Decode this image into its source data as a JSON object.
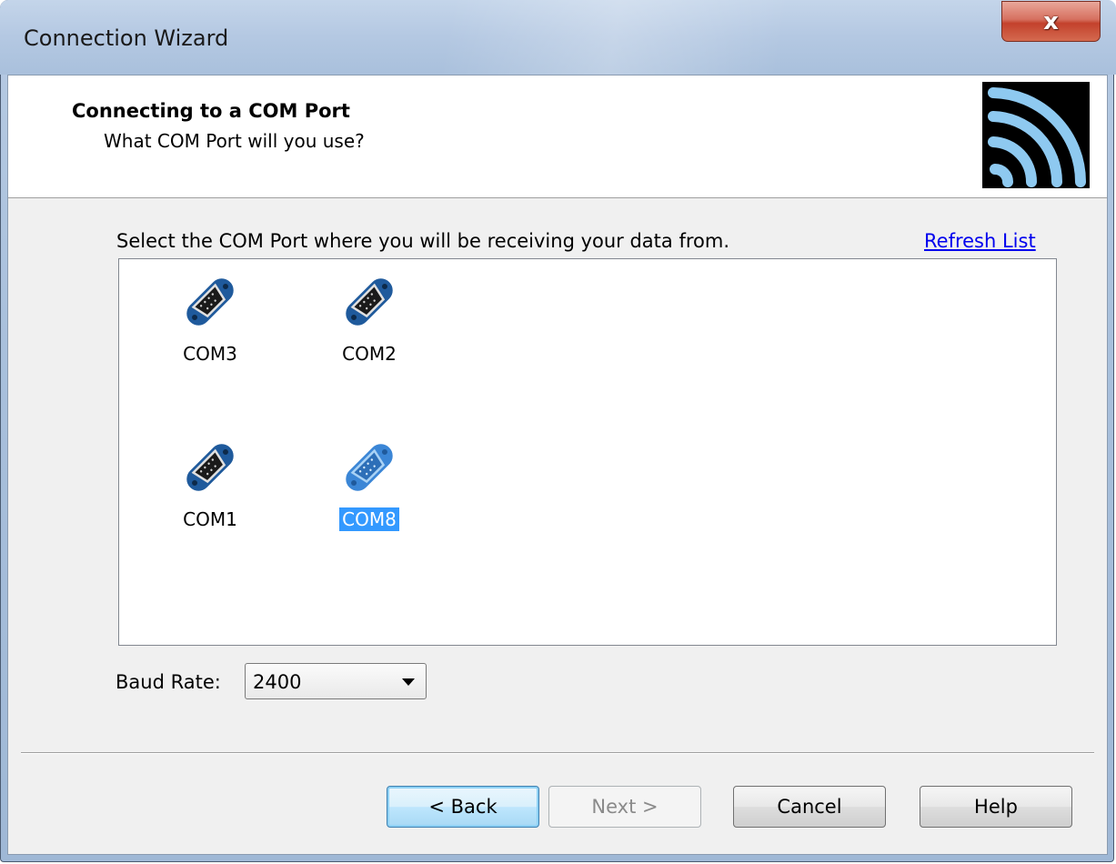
{
  "window": {
    "title": "Connection Wizard",
    "close_label": "x"
  },
  "header": {
    "heading": "Connecting to a COM Port",
    "subheading": "What COM Port will you use?"
  },
  "main": {
    "instruction": "Select the COM Port where you will be receiving your data from.",
    "refresh_label": "Refresh List",
    "ports": [
      {
        "label": "COM3",
        "selected": false
      },
      {
        "label": "COM2",
        "selected": false
      },
      {
        "label": "COM1",
        "selected": false
      },
      {
        "label": "COM8",
        "selected": true
      }
    ],
    "baud_label": "Baud Rate:",
    "baud_value": "2400"
  },
  "buttons": {
    "back": "< Back",
    "next": "Next >",
    "cancel": "Cancel",
    "help": "Help"
  },
  "colors": {
    "selection": "#3399ff",
    "link": "#0000ee",
    "icon_blue": "#1f5a9c",
    "signal_blue": "#8ec9f0"
  }
}
